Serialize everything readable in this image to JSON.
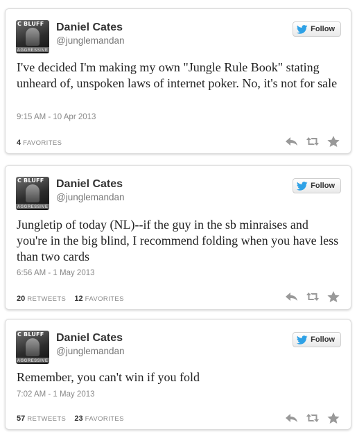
{
  "tweets": [
    {
      "avatar_logo": "C BLUFF",
      "avatar_banner": "AGGRESSIVE",
      "name": "Daniel Cates",
      "handle": "@junglemandan",
      "follow_label": "Follow",
      "text": "I've decided I'm making my own \"Jungle Rule Book\" stating unheard of, unspoken laws of internet poker. No, it's not for sale",
      "timestamp": "9:15 AM - 10 Apr 2013",
      "retweets": "",
      "retweets_label": "",
      "favorites": "4",
      "favorites_label": "FAVORITES"
    },
    {
      "avatar_logo": "C BLUFF",
      "avatar_banner": "AGGRESSIVE",
      "name": "Daniel Cates",
      "handle": "@junglemandan",
      "follow_label": "Follow",
      "text": "Jungletip of today (NL)--if the guy in the sb minraises and you're in the big blind, I recommend folding when you have less than two cards",
      "timestamp": "6:56 AM - 1 May 2013",
      "retweets": "20",
      "retweets_label": "RETWEETS",
      "favorites": "12",
      "favorites_label": "FAVORITES"
    },
    {
      "avatar_logo": "C BLUFF",
      "avatar_banner": "AGGRESSIVE",
      "name": "Daniel Cates",
      "handle": "@junglemandan",
      "follow_label": "Follow",
      "text": "Remember, you can't win if you fold",
      "timestamp": "7:02 AM - 1 May 2013",
      "retweets": "57",
      "retweets_label": "RETWEETS",
      "favorites": "23",
      "favorites_label": "FAVORITES"
    }
  ],
  "icons": {
    "follow": "twitter-bird-icon",
    "reply": "reply-icon",
    "retweet": "retweet-icon",
    "favorite": "star-icon"
  },
  "colors": {
    "twitter_blue": "#2ea1e6",
    "action_gray": "#999999"
  }
}
